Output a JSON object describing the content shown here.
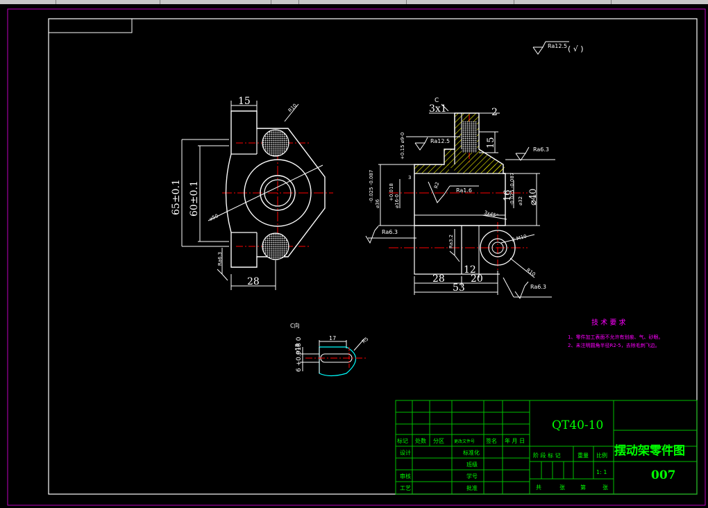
{
  "roughness_note": {
    "symbol": "Ra12.5",
    "suffix": "( √ )"
  },
  "left_view": {
    "dim_top_width": "15",
    "dim_bottom_width": "28",
    "dim_outer_height": "65±0.1",
    "dim_inner_height": "60±0.1",
    "dim_radius": "R10",
    "dim_diameter": "⌀50",
    "surface_left": "Ra6.3"
  },
  "section_view": {
    "view_label": "C",
    "chamfer": "3x1",
    "dim_top_offset": "2",
    "dim_tab_height": "15",
    "tab_tolerance": "+0.15 ⌀9-0",
    "surface_top": "Ra12.5",
    "surface_right": "Ra6.3",
    "bore_left_a": "-0.025 -0.087",
    "bore_left_b": "⌀36",
    "bore_small_a": "+0.018",
    "bore_small_b": "⌀16-0",
    "bore_right_a": "-0.025 -0.087",
    "bore_right_b": "⌀32",
    "dim_16": "16",
    "dim_40": "⌀40",
    "chamfer_small": "3x45°",
    "surface_inner": "Ra1.6",
    "dim_3": "3",
    "dim_r2": "R2",
    "surface_left": "Ra6.3",
    "surface_bottom_v": "Ra3.2",
    "thread": "2-M10",
    "radius_small": "R10",
    "surface_bottom_r": "Ra6.3",
    "dim_28": "28",
    "dim_12": "12",
    "dim_20": "20",
    "dim_53": "53"
  },
  "c_view": {
    "label": "C向",
    "dim_width": "17",
    "dim_r": "R5",
    "dim_vertical": "6 +0.018 0",
    "dim_small": "⌀18"
  },
  "tech_requirements": {
    "title": "技 术 要 求",
    "items": [
      "1、零件加工表面不允许有划痕、气、砂眼。",
      "2、未注明圆角半径R2-5，去除毛刺飞边。"
    ]
  },
  "title_block": {
    "material": "QT40-10",
    "part_name": "摆动架零件图",
    "drawing_no": "007",
    "scale": "1: 1",
    "header_row": [
      "标记",
      "处数",
      "分区",
      "更改文件号",
      "签名",
      "年 月 日"
    ],
    "label_design": "设计",
    "label_standard": "标准化",
    "label_class": "班级",
    "label_check": "审核",
    "label_id": "学号",
    "label_process": "工艺",
    "label_approve": "批准",
    "stage_row": [
      "阶 段 标 记",
      "重量",
      "比例"
    ],
    "sheet_row": [
      "共",
      "张",
      "第",
      "张"
    ]
  },
  "colors": {
    "background": "#000000",
    "outline": "#ffffff",
    "frame": "#c000c0",
    "centerline": "#ff0000",
    "table": "#00c000",
    "text_green": "#00ff00",
    "text_magenta": "#ff00ff",
    "hatch": "#ffff00",
    "cyan": "#00ffff"
  }
}
